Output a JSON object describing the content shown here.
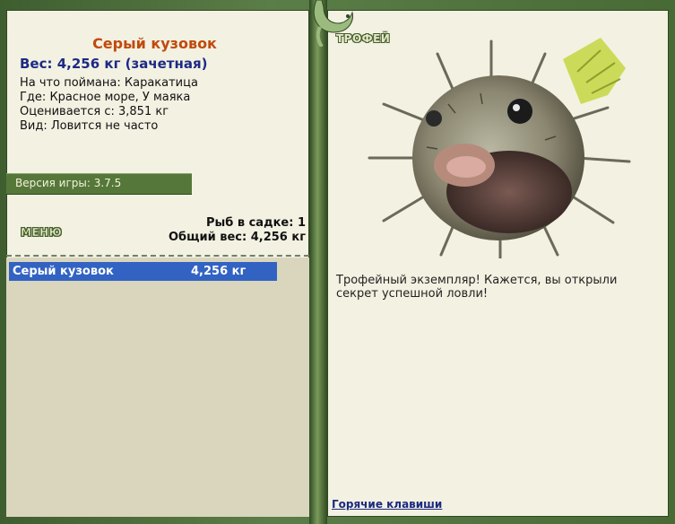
{
  "fish": {
    "name": "Серый кузовок",
    "weight_line": "Вес: 4,256 кг (зачетная)",
    "details": [
      {
        "label": "На что поймана:",
        "value": "Каракатица"
      },
      {
        "label": "Где:",
        "value": "Красное море, У маяка"
      },
      {
        "label": "Оценивается с:",
        "value": "3,851 кг"
      },
      {
        "label": "Вид:",
        "value": "Ловится не часто"
      }
    ]
  },
  "version": {
    "text": "Версия игры: 3.7.5"
  },
  "menu": {
    "heading": "МЕНЮ"
  },
  "keep": {
    "count_label": "Рыб в садке:",
    "count_value": "1",
    "total_label": "Общий вес:",
    "total_value": "4,256 кг"
  },
  "catch_list": [
    {
      "name": "Серый кузовок",
      "weight": "4,256 кг"
    }
  ],
  "trophy": {
    "heading": "ТРОФЕЙ",
    "image_icon": "porcupinefish-image",
    "text": "Трофейный экземпляр! Кажется, вы открыли секрет успешной ловли!"
  },
  "footer": {
    "hotkeys_label": "Горячие клавиши"
  },
  "colors": {
    "frame_green": "#4e6e3c",
    "panel_bg": "#f3f1e2",
    "title_orange": "#c04a0c",
    "weight_blue": "#1d2a84",
    "selected_row": "#3263c3",
    "list_bg": "#d9d6bd"
  }
}
